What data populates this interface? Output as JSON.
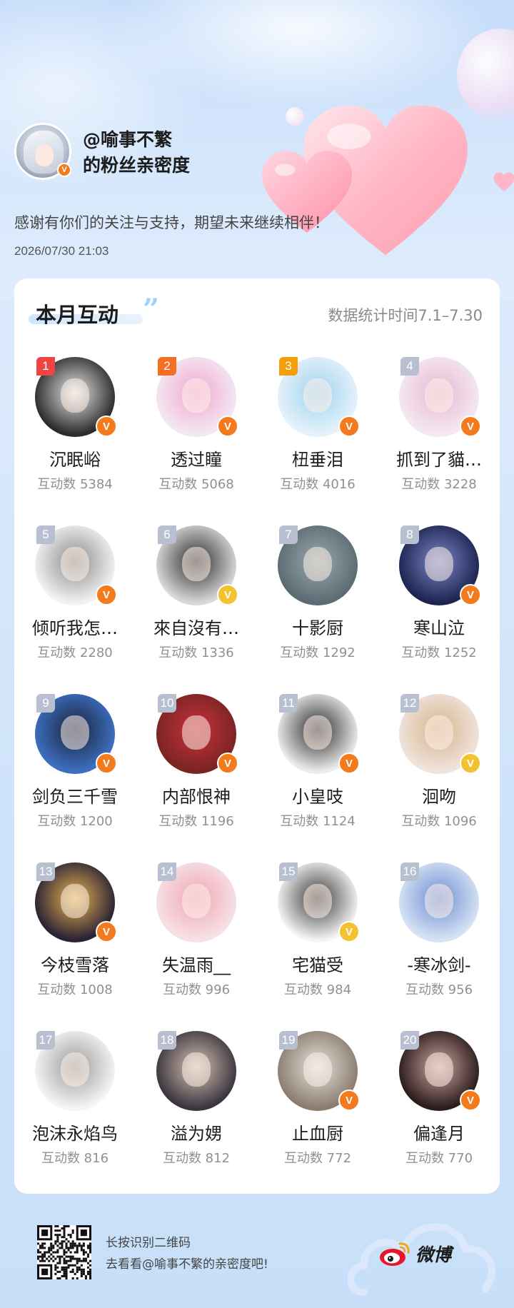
{
  "header": {
    "username": "@喻事不繁",
    "subtitle": "的粉丝亲密度",
    "thanks": "感谢有你们的关注与支持，期望未来继续相伴！",
    "timestamp": "2026/07/30 21:03"
  },
  "card": {
    "title": "本月互动",
    "period": "数据统计时间7.1–7.30",
    "fans": [
      {
        "rank": "1",
        "name": "沉眠峪",
        "count": "互动数 5384",
        "badge": "orange",
        "bg": "#2b2b2b",
        "fg": "#e9e9e9"
      },
      {
        "rank": "2",
        "name": "透过瞳",
        "count": "互动数 5068",
        "badge": "orange",
        "bg": "#f3e8f2",
        "fg": "#f2a8cf"
      },
      {
        "rank": "3",
        "name": "杻垂泪",
        "count": "互动数 4016",
        "badge": "orange",
        "bg": "#e6f2fa",
        "fg": "#9fd3f0"
      },
      {
        "rank": "4",
        "name": "抓到了貓…",
        "count": "互动数 3228",
        "badge": "orange",
        "bg": "#f4e9f1",
        "fg": "#e9b6d3"
      },
      {
        "rank": "5",
        "name": "倾听我怎…",
        "count": "互动数 2280",
        "badge": "orange",
        "bg": "#f2f2f2",
        "fg": "#8b8b8b"
      },
      {
        "rank": "6",
        "name": "來自沒有…",
        "count": "互动数 1336",
        "badge": "yellow",
        "bg": "#d9d9d9",
        "fg": "#2c2c2c"
      },
      {
        "rank": "7",
        "name": "十影厨",
        "count": "互动数 1292",
        "badge": "none",
        "bg": "#5b6b73",
        "fg": "#9aa9ae"
      },
      {
        "rank": "8",
        "name": "寒山泣",
        "count": "互动数 1252",
        "badge": "orange",
        "bg": "#1d2450",
        "fg": "#7b86c8"
      },
      {
        "rank": "9",
        "name": "剑负三千雪",
        "count": "互动数 1200",
        "badge": "orange",
        "bg": "#3d6fc1",
        "fg": "#1a2238"
      },
      {
        "rank": "10",
        "name": "内部恨神",
        "count": "互动数 1196",
        "badge": "orange",
        "bg": "#7a2424",
        "fg": "#c7323a"
      },
      {
        "rank": "11",
        "name": "小皇吱",
        "count": "互动数 1124",
        "badge": "orange",
        "bg": "#ececec",
        "fg": "#2a2a2a"
      },
      {
        "rank": "12",
        "name": "洄吻",
        "count": "互动数 1096",
        "badge": "yellow",
        "bg": "#efe4dc",
        "fg": "#d7b48d"
      },
      {
        "rank": "13",
        "name": "今枝雪落",
        "count": "互动数 1008",
        "badge": "orange",
        "bg": "#2a2233",
        "fg": "#e8b454"
      },
      {
        "rank": "14",
        "name": "失温雨__",
        "count": "互动数 996",
        "badge": "none",
        "bg": "#f6e2e6",
        "fg": "#f0a5b4"
      },
      {
        "rank": "15",
        "name": "宅猫受",
        "count": "互动数 984",
        "badge": "yellow",
        "bg": "#f4f4f4",
        "fg": "#3a3a3a"
      },
      {
        "rank": "16",
        "name": "-寒冰剑-",
        "count": "互动数 956",
        "badge": "none",
        "bg": "#d5e3f4",
        "fg": "#6f8ed2"
      },
      {
        "rank": "17",
        "name": "泡沫永焰鸟",
        "count": "互动数 816",
        "badge": "none",
        "bg": "#f5f5f5",
        "fg": "#9b9b9b"
      },
      {
        "rank": "18",
        "name": "溢为娚",
        "count": "互动数 812",
        "badge": "none",
        "bg": "#3a3540",
        "fg": "#d8c2b2"
      },
      {
        "rank": "19",
        "name": "止血厨",
        "count": "互动数 772",
        "badge": "orange",
        "bg": "#8a7d6f",
        "fg": "#e7e2dc"
      },
      {
        "rank": "20",
        "name": "偏逢月",
        "count": "互动数 770",
        "badge": "orange",
        "bg": "#2a1c1c",
        "fg": "#cfa5a0"
      }
    ]
  },
  "footer": {
    "line1": "长按识别二维码",
    "line2": "去看看@喻事不繁的亲密度吧!",
    "brand": "微博"
  },
  "colors": {
    "rank1": "#ef4444",
    "rank2": "#f46f22",
    "rank3": "#f59e0b",
    "rank_other": "#b7bfd1",
    "badge_orange": "#f37b1d",
    "badge_yellow": "#f2c230",
    "weibo_red": "#e6162d"
  },
  "icons": {
    "verified": "V",
    "weibo": "weibo-eye-icon"
  }
}
